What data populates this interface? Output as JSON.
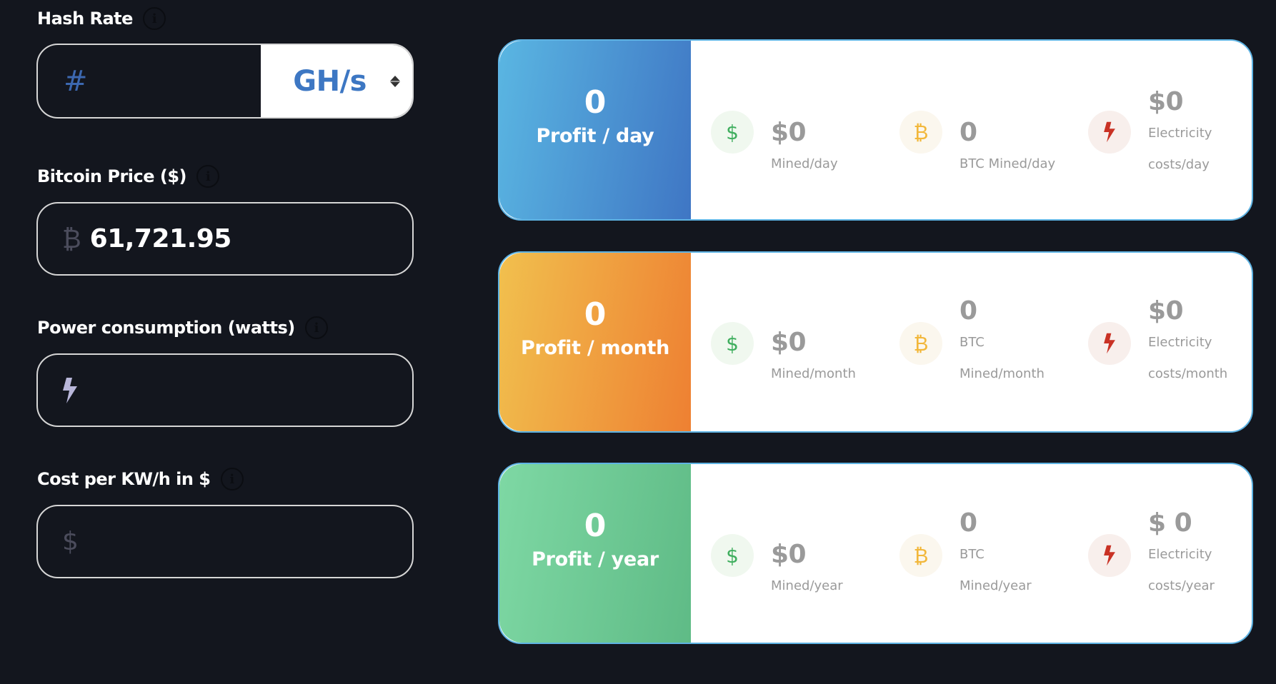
{
  "form": {
    "hash_rate": {
      "label": "Hash Rate",
      "prefix": "#",
      "value": "",
      "placeholder": "",
      "unit_selected": "GH/s"
    },
    "bitcoin_price": {
      "label": "Bitcoin Price ($)",
      "prefix": "₿",
      "value": "61,721.95"
    },
    "power": {
      "label": "Power consumption (watts)",
      "value": ""
    },
    "cost": {
      "label": "Cost per KW/h in $",
      "prefix": "$",
      "value": ""
    },
    "info_glyph": "i"
  },
  "results": {
    "day": {
      "profit_value": "0",
      "profit_label": "Profit / day",
      "mined_value": "$0",
      "mined_label": "Mined/day",
      "btc_value": "0",
      "btc_label_1": "BTC Mined/day",
      "btc_label_2": "",
      "elec_value": "$0",
      "elec_label_1": "Electricity",
      "elec_label_2": "costs/day"
    },
    "month": {
      "profit_value": "0",
      "profit_label": "Profit / month",
      "mined_value": "$0",
      "mined_label": "Mined/month",
      "btc_value": "0",
      "btc_label_1": "BTC",
      "btc_label_2": "Mined/month",
      "elec_value": "$0",
      "elec_label_1": "Electricity",
      "elec_label_2": "costs/month"
    },
    "year": {
      "profit_value": "0",
      "profit_label": "Profit / year",
      "mined_value": "$0",
      "mined_label": "Mined/year",
      "btc_value": "0",
      "btc_label_1": "BTC",
      "btc_label_2": "Mined/year",
      "elec_value": "$ 0",
      "elec_label_1": "Electricity",
      "elec_label_2": "costs/year"
    }
  },
  "icons": {
    "dollar": "$",
    "bitcoin": "₿"
  },
  "colors": {
    "background": "#13161e",
    "day_gradient": [
      "#5ab6e2",
      "#3f76c4"
    ],
    "month_gradient": [
      "#f1c04e",
      "#ee8032"
    ],
    "year_gradient": [
      "#7ed8a4",
      "#5fbb86"
    ],
    "card_border": "#5eb3e3",
    "unit_text": "#3d77c3"
  }
}
